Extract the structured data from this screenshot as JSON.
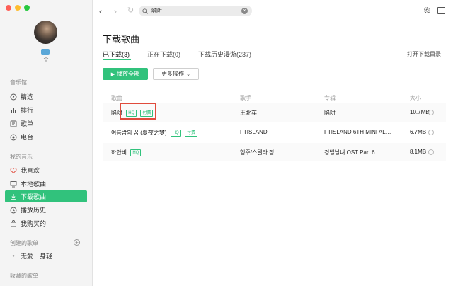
{
  "sidebar": {
    "section_music_hall": "音乐馆",
    "music_hall_items": [
      {
        "label": "精选",
        "icon": "compass-icon"
      },
      {
        "label": "排行",
        "icon": "chart-icon"
      },
      {
        "label": "歌单",
        "icon": "playlist-icon"
      },
      {
        "label": "电台",
        "icon": "radio-icon"
      }
    ],
    "section_my_music": "我的音乐",
    "my_music_items": [
      {
        "label": "我喜欢",
        "icon": "heart-icon"
      },
      {
        "label": "本地歌曲",
        "icon": "monitor-icon"
      },
      {
        "label": "下载歌曲",
        "icon": "download-icon",
        "active": true
      },
      {
        "label": "播放历史",
        "icon": "clock-icon"
      },
      {
        "label": "我购买的",
        "icon": "bag-icon"
      }
    ],
    "section_created": "创建的歌单",
    "created_items": [
      {
        "label": "无爱一身轻"
      }
    ],
    "section_collected": "收藏的歌单"
  },
  "topbar": {
    "search_value": "陷阱"
  },
  "main": {
    "title": "下载歌曲",
    "tabs": [
      {
        "label": "已下载(3)",
        "active": true
      },
      {
        "label": "正在下载(0)"
      },
      {
        "label": "下载历史漫游(237)"
      }
    ],
    "open_dir": "打开下载目录",
    "play_all": "播放全部",
    "more_ops": "更多操作",
    "columns": [
      "歌曲",
      "歌手",
      "专辑",
      "大小"
    ],
    "rows": [
      {
        "song": "陷阱",
        "tags": [
          "HQ",
          "付费"
        ],
        "artist": "王北车",
        "album": "陷阱",
        "size": "10.7MB"
      },
      {
        "song": "여름밤의 꿈 (夏夜之梦)",
        "tags": [
          "HQ",
          "付费"
        ],
        "artist": "FTISLAND",
        "album": "FTISLAND 6TH MINI AL…",
        "size": "6.7MB"
      },
      {
        "song": "하얀비",
        "tags": [
          "HQ"
        ],
        "artist": "행주/스텔라 장",
        "album": "경법남녀 OST Part.6",
        "size": "8.1MB"
      }
    ]
  },
  "colors": {
    "accent": "#31c27c",
    "highlight": "#e04b3c"
  }
}
